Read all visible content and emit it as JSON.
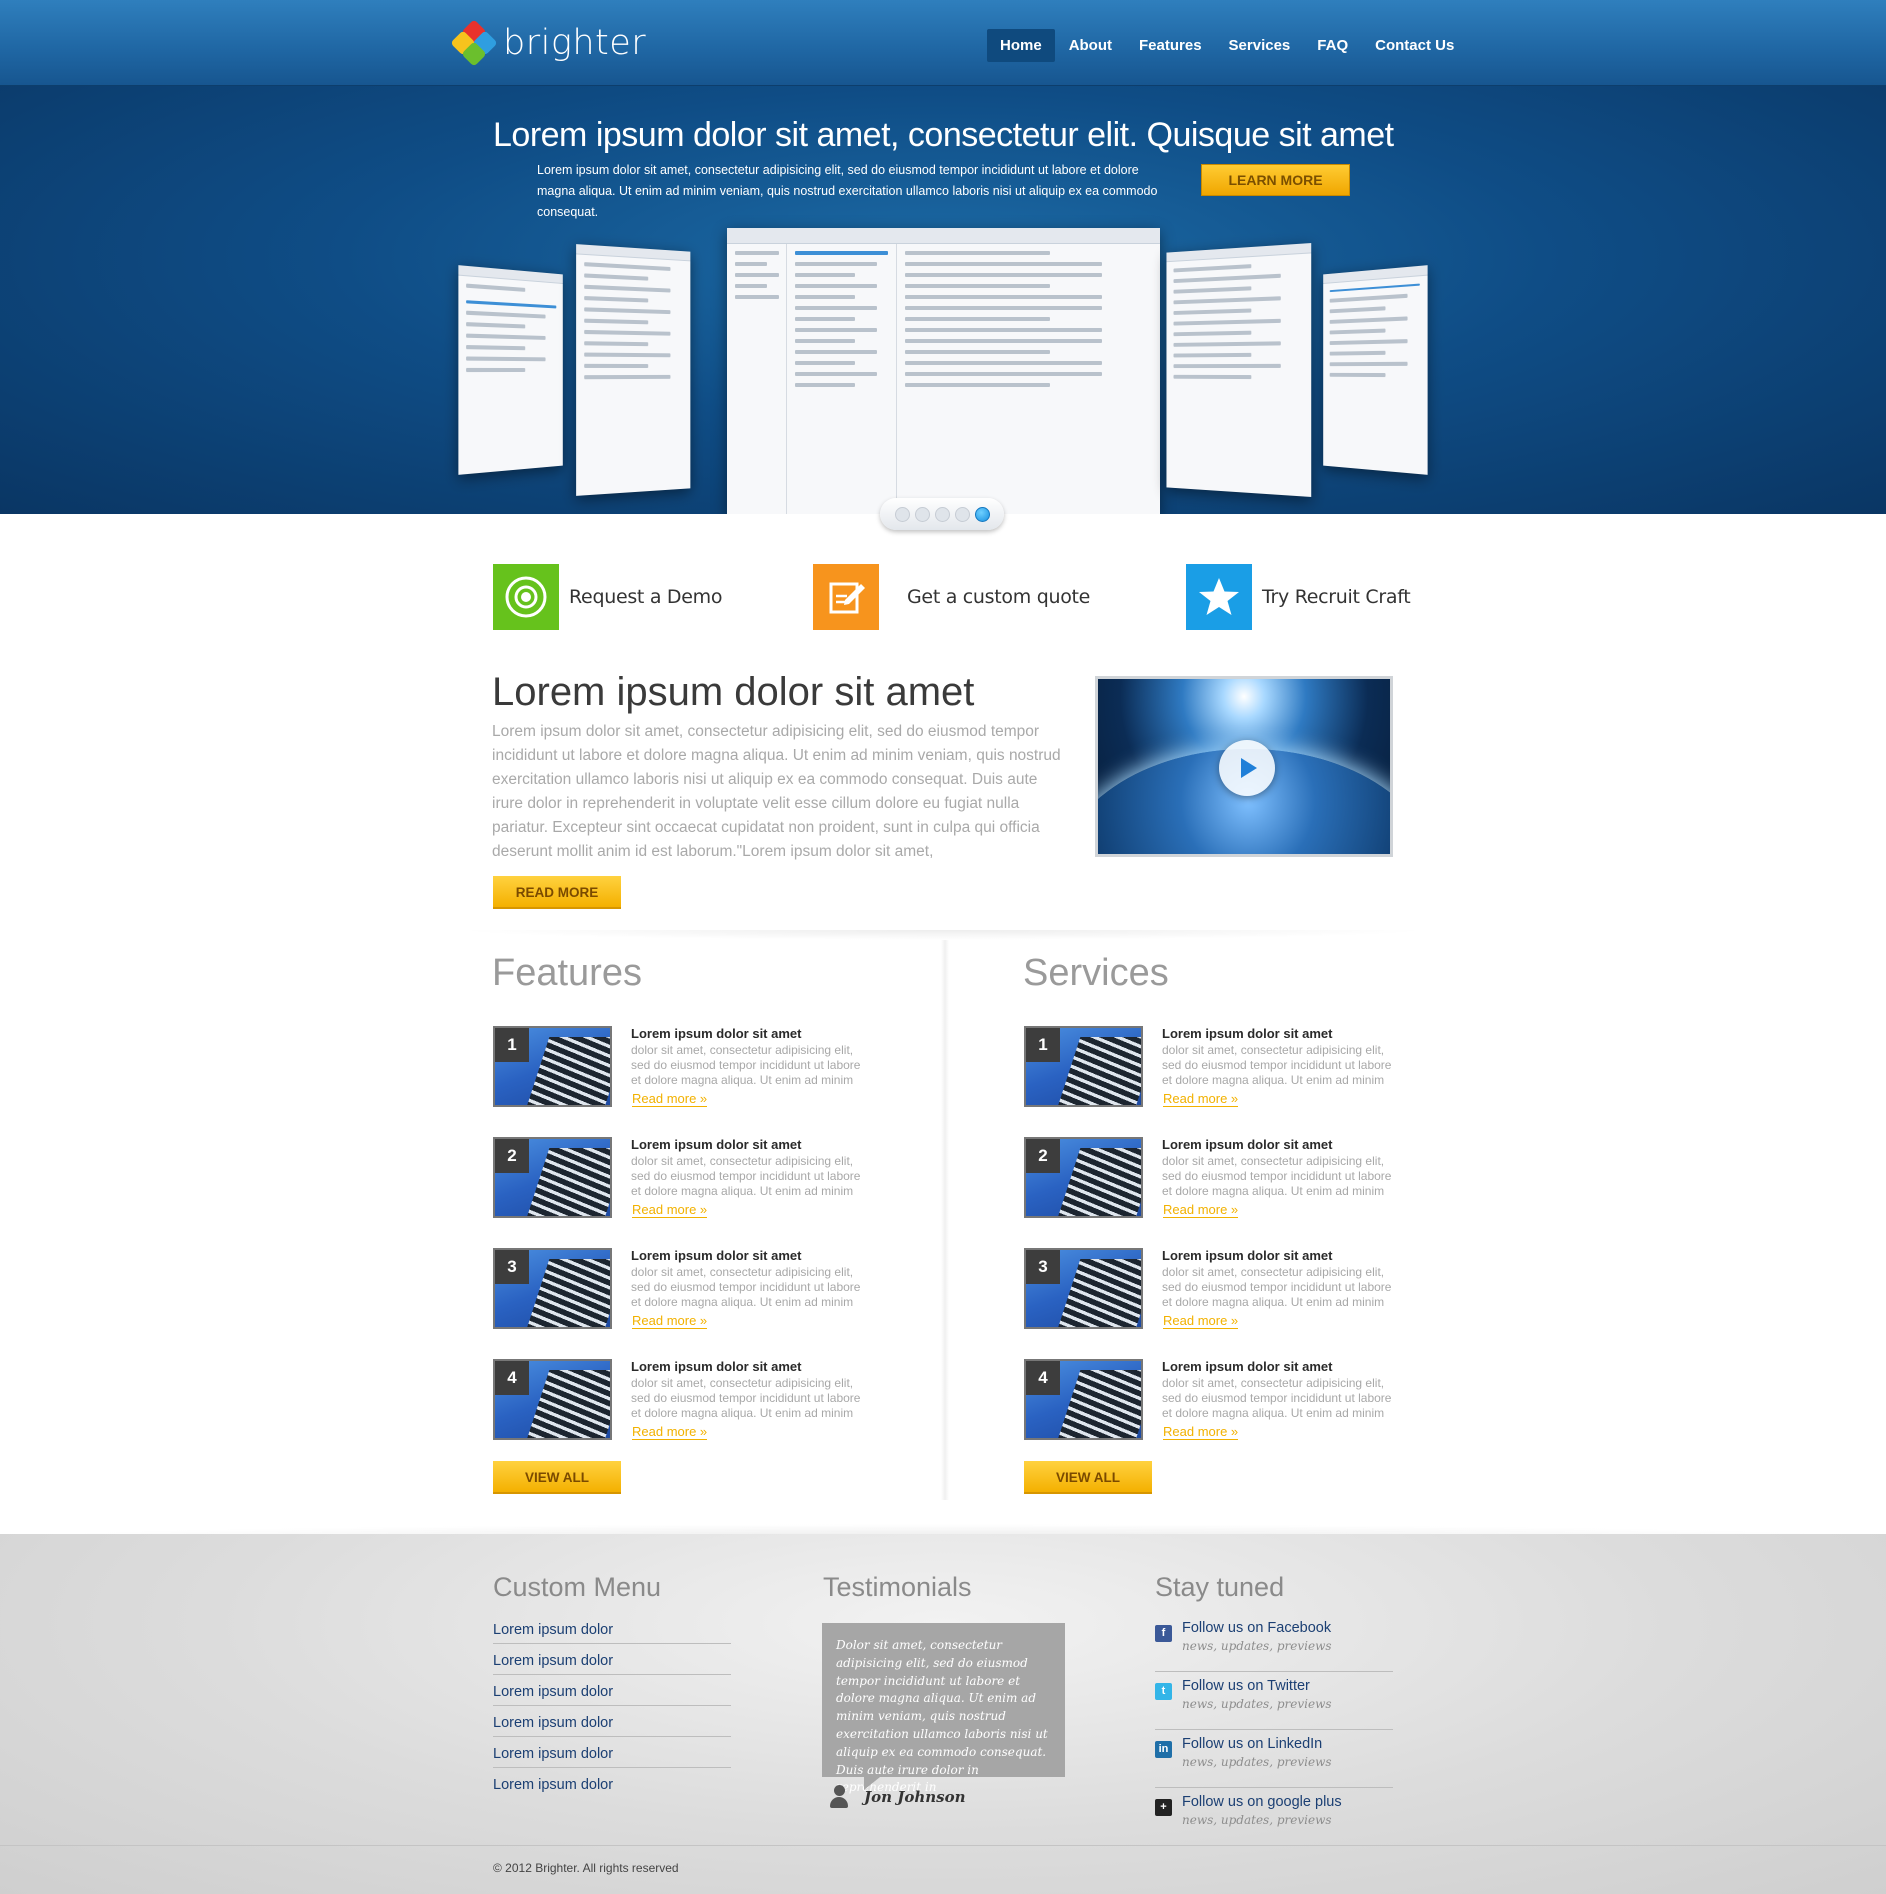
{
  "brand": {
    "name": "brighter"
  },
  "nav": {
    "items": [
      {
        "label": "Home",
        "active": true
      },
      {
        "label": "About"
      },
      {
        "label": "Features"
      },
      {
        "label": "Services"
      },
      {
        "label": "FAQ"
      },
      {
        "label": "Contact Us"
      }
    ]
  },
  "hero": {
    "title": "Lorem ipsum dolor sit amet, consectetur elit. Quisque sit amet",
    "subtitle": "Lorem ipsum dolor sit amet, consectetur adipisicing elit, sed do eiusmod tempor incididunt ut labore et dolore magna aliqua. Ut enim ad minim veniam, quis nostrud exercitation ullamco laboris nisi ut aliquip ex ea commodo consequat.",
    "cta_label": "LEARN MORE",
    "slider_dots": 5,
    "active_dot": 5
  },
  "actions": [
    {
      "label": "Request a Demo",
      "icon": "target-icon",
      "color": "#66c21c"
    },
    {
      "label": "Get a custom quote",
      "icon": "edit-icon",
      "color": "#f7941d"
    },
    {
      "label": "Try Recruit Craft",
      "icon": "star-icon",
      "color": "#1a9ee6"
    }
  ],
  "intro": {
    "title": "Lorem ipsum dolor sit amet",
    "body": "Lorem ipsum dolor sit amet, consectetur adipisicing elit, sed do eiusmod tempor incididunt ut labore et dolore magna aliqua. Ut enim ad minim veniam, quis nostrud exercitation ullamco laboris nisi ut aliquip ex ea commodo consequat. Duis aute irure dolor in reprehenderit in voluptate velit esse cillum dolore eu fugiat nulla pariatur. Excepteur sint occaecat cupidatat non proident, sunt in culpa qui officia deserunt mollit anim id est laborum.\"Lorem ipsum dolor sit amet,",
    "button": "READ MORE"
  },
  "features": {
    "title": "Features",
    "button": "VIEW ALL",
    "items": [
      {
        "num": "1",
        "title": "Lorem ipsum dolor sit amet",
        "text": "dolor sit amet, consectetur adipisicing elit, sed do eiusmod tempor incididunt ut labore et dolore magna aliqua. Ut enim ad minim",
        "link": "Read more »"
      },
      {
        "num": "2",
        "title": "Lorem ipsum dolor sit amet",
        "text": "dolor sit amet, consectetur adipisicing elit, sed do eiusmod tempor incididunt ut labore et dolore magna aliqua. Ut enim ad minim",
        "link": "Read more »"
      },
      {
        "num": "3",
        "title": "Lorem ipsum dolor sit amet",
        "text": "dolor sit amet, consectetur adipisicing elit, sed do eiusmod tempor incididunt ut labore et dolore magna aliqua. Ut enim ad minim",
        "link": "Read more »"
      },
      {
        "num": "4",
        "title": "Lorem ipsum dolor sit amet",
        "text": "dolor sit amet, consectetur adipisicing elit, sed do eiusmod tempor incididunt ut labore et dolore magna aliqua. Ut enim ad minim",
        "link": "Read more »"
      }
    ]
  },
  "services": {
    "title": "Services",
    "button": "VIEW ALL",
    "items": [
      {
        "num": "1",
        "title": "Lorem ipsum dolor sit amet",
        "text": "dolor sit amet, consectetur adipisicing elit, sed do eiusmod tempor incididunt ut labore et dolore magna aliqua. Ut enim ad minim",
        "link": "Read more »"
      },
      {
        "num": "2",
        "title": "Lorem ipsum dolor sit amet",
        "text": "dolor sit amet, consectetur adipisicing elit, sed do eiusmod tempor incididunt ut labore et dolore magna aliqua. Ut enim ad minim",
        "link": "Read more »"
      },
      {
        "num": "3",
        "title": "Lorem ipsum dolor sit amet",
        "text": "dolor sit amet, consectetur adipisicing elit, sed do eiusmod tempor incididunt ut labore et dolore magna aliqua. Ut enim ad minim",
        "link": "Read more »"
      },
      {
        "num": "4",
        "title": "Lorem ipsum dolor sit amet",
        "text": "dolor sit amet, consectetur adipisicing elit, sed do eiusmod tempor incididunt ut labore et dolore magna aliqua. Ut enim ad minim",
        "link": "Read more »"
      }
    ]
  },
  "footer": {
    "menu": {
      "title": "Custom Menu",
      "items": [
        "Lorem ipsum dolor",
        "Lorem ipsum dolor",
        "Lorem ipsum dolor",
        "Lorem ipsum dolor",
        "Lorem ipsum dolor",
        "Lorem ipsum dolor"
      ]
    },
    "testimonials": {
      "title": "Testimonials",
      "quote": "Dolor sit amet, consectetur adipisicing elit, sed do eiusmod tempor incididunt ut labore et dolore magna aliqua. Ut enim ad minim veniam, quis nostrud exercitation ullamco laboris nisi ut aliquip ex ea commodo consequat. Duis aute irure dolor in reprehenderit in",
      "author": "Jon Johnson"
    },
    "social": {
      "title": "Stay tuned",
      "items": [
        {
          "label": "Follow us on Facebook",
          "sub": "news, updates, previews",
          "icon": "facebook-icon",
          "color": "#3b5998"
        },
        {
          "label": "Follow us on Twitter",
          "sub": "news, updates, previews",
          "icon": "twitter-icon",
          "color": "#33b5e8"
        },
        {
          "label": "Follow us on LinkedIn",
          "sub": "news, updates, previews",
          "icon": "linkedin-icon",
          "color": "#1f6fa8"
        },
        {
          "label": "Follow us on google plus",
          "sub": "news, updates, previews",
          "icon": "google-plus-icon",
          "color": "#222222"
        }
      ]
    },
    "copyright": "© 2012 Brighter. All rights reserved"
  }
}
